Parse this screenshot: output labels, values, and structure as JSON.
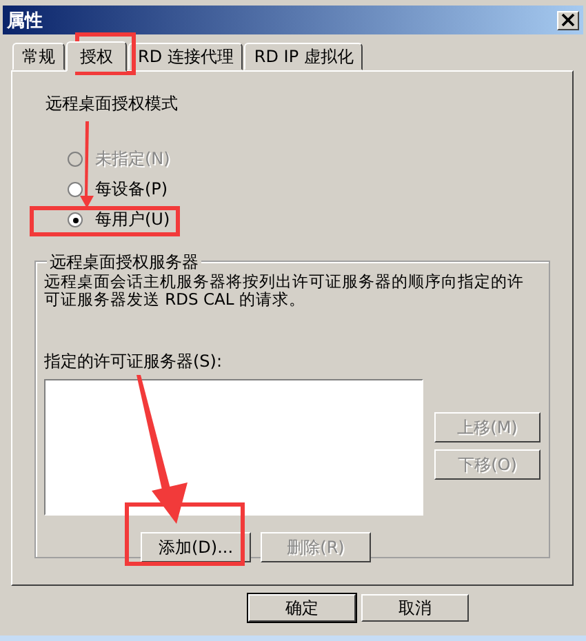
{
  "window": {
    "title": "属性"
  },
  "tabs": [
    {
      "label": "常规",
      "selected": false
    },
    {
      "label": "授权",
      "selected": true
    },
    {
      "label": "RD 连接代理",
      "selected": false
    },
    {
      "label": "RD IP 虚拟化",
      "selected": false
    }
  ],
  "mode": {
    "title": "远程桌面授权模式",
    "options": [
      {
        "label": "未指定(N)",
        "selected": false,
        "disabled": true
      },
      {
        "label": "每设备(P)",
        "selected": false,
        "disabled": false
      },
      {
        "label": "每用户(U)",
        "selected": true,
        "disabled": false
      }
    ]
  },
  "servers": {
    "title": "远程桌面授权服务器",
    "description": "远程桌面会话主机服务器将按列出许可证服务器的顺序向指定的许可证服务器发送 RDS CAL 的请求。",
    "list_label": "指定的许可证服务器(S):",
    "side_buttons": [
      {
        "label": "上移(M)",
        "disabled": true
      },
      {
        "label": "下移(O)",
        "disabled": true
      }
    ],
    "action_buttons": [
      {
        "label": "添加(D)...",
        "disabled": false
      },
      {
        "label": "删除(R)",
        "disabled": true
      }
    ]
  },
  "dialog_buttons": [
    {
      "label": "确定",
      "default": true
    },
    {
      "label": "取消",
      "default": false
    }
  ]
}
